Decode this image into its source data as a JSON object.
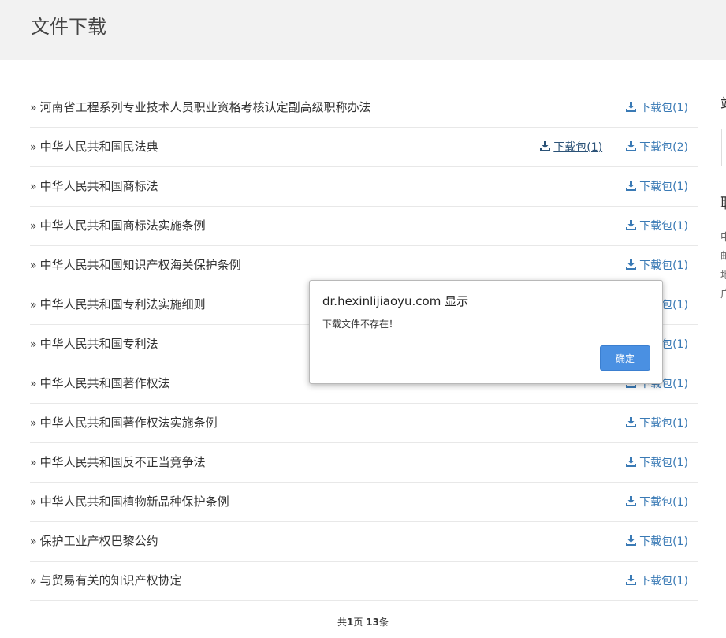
{
  "header": {
    "title": "文件下载"
  },
  "files": [
    {
      "name": "河南省工程系列专业技术人员职业资格考核认定副高级职称办法",
      "downloads": [
        {
          "label": "下载包(1)",
          "style": "normal"
        }
      ]
    },
    {
      "name": "中华人民共和国民法典",
      "downloads": [
        {
          "label": "下载包(1)",
          "style": "visited"
        },
        {
          "label": "下载包(2)",
          "style": "normal"
        }
      ]
    },
    {
      "name": "中华人民共和国商标法",
      "downloads": [
        {
          "label": "下载包(1)",
          "style": "normal"
        }
      ]
    },
    {
      "name": "中华人民共和国商标法实施条例",
      "downloads": [
        {
          "label": "下载包(1)",
          "style": "normal"
        }
      ]
    },
    {
      "name": "中华人民共和国知识产权海关保护条例",
      "downloads": [
        {
          "label": "下载包(1)",
          "style": "normal"
        }
      ]
    },
    {
      "name": "中华人民共和国专利法实施细则",
      "downloads": [
        {
          "label": "下载包(1)",
          "style": "normal"
        }
      ]
    },
    {
      "name": "中华人民共和国专利法",
      "downloads": [
        {
          "label": "下载包(1)",
          "style": "normal"
        }
      ]
    },
    {
      "name": "中华人民共和国著作权法",
      "downloads": [
        {
          "label": "下载包(1)",
          "style": "normal"
        }
      ]
    },
    {
      "name": "中华人民共和国著作权法实施条例",
      "downloads": [
        {
          "label": "下载包(1)",
          "style": "normal"
        }
      ]
    },
    {
      "name": "中华人民共和国反不正当竞争法",
      "downloads": [
        {
          "label": "下载包(1)",
          "style": "normal"
        }
      ]
    },
    {
      "name": "中华人民共和国植物新品种保护条例",
      "downloads": [
        {
          "label": "下载包(1)",
          "style": "normal"
        }
      ]
    },
    {
      "name": "保护工业产权巴黎公约",
      "downloads": [
        {
          "label": "下载包(1)",
          "style": "normal"
        }
      ]
    },
    {
      "name": "与贸易有关的知识产权协定",
      "downloads": [
        {
          "label": "下载包(1)",
          "style": "normal"
        }
      ]
    }
  ],
  "bullet": "»",
  "pager": {
    "prefix": "共",
    "pages": "1",
    "page_unit": "页 ",
    "count": "13",
    "count_unit": "条"
  },
  "sidebar": {
    "heading1": "站",
    "heading2": "联",
    "text_lines": [
      "中",
      "邮",
      "地",
      "广"
    ]
  },
  "dialog": {
    "title": "dr.hexinlijiaoyu.com 显示",
    "message": "下载文件不存在！",
    "ok_label": "确定"
  },
  "colors": {
    "link": "#3a7ab5",
    "link_visited": "#2b5277",
    "header_bg": "#f2f2f2",
    "button": "#4a90e2"
  },
  "icons": {
    "download": "download-icon",
    "bullet": "double-chevron-right"
  }
}
